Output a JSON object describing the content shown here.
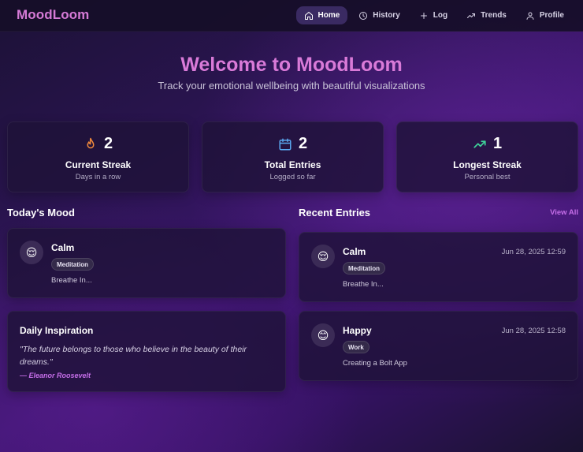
{
  "app": {
    "brand": "MoodLoom"
  },
  "nav": {
    "items": [
      {
        "label": "Home",
        "icon": "home-icon",
        "active": true
      },
      {
        "label": "History",
        "icon": "clock-icon",
        "active": false
      },
      {
        "label": "Log",
        "icon": "plus-icon",
        "active": false
      },
      {
        "label": "Trends",
        "icon": "trend-icon",
        "active": false
      },
      {
        "label": "Profile",
        "icon": "user-icon",
        "active": false
      }
    ]
  },
  "hero": {
    "title": "Welcome to MoodLoom",
    "subtitle": "Track your emotional wellbeing with beautiful visualizations"
  },
  "stats": [
    {
      "value": "2",
      "label": "Current Streak",
      "sub": "Days in a row",
      "icon": "flame-icon",
      "color": "#f28a3c"
    },
    {
      "value": "2",
      "label": "Total Entries",
      "sub": "Logged so far",
      "icon": "calendar-icon",
      "color": "#5aa8f0"
    },
    {
      "value": "1",
      "label": "Longest Streak",
      "sub": "Personal best",
      "icon": "trending-up-icon",
      "color": "#3fd49a"
    }
  ],
  "today": {
    "title": "Today's Mood",
    "mood": "Calm",
    "emoji": "😌",
    "tag": "Meditation",
    "note": "Breathe In..."
  },
  "inspiration": {
    "title": "Daily Inspiration",
    "quote": "\"The future belongs to those who believe in the beauty of their dreams.\"",
    "author": "— Eleanor Roosevelt"
  },
  "recent": {
    "title": "Recent Entries",
    "view_all": "View All",
    "entries": [
      {
        "mood": "Calm",
        "emoji": "😌",
        "tag": "Meditation",
        "note": "Breathe In...",
        "date": "Jun 28, 2025 12:59"
      },
      {
        "mood": "Happy",
        "emoji": "😊",
        "tag": "Work",
        "note": "Creating a Bolt App",
        "date": "Jun 28, 2025 12:58"
      }
    ]
  },
  "colors": {
    "accent": "#d57ad6",
    "link": "#c56ee8",
    "card": "#1e1238"
  }
}
